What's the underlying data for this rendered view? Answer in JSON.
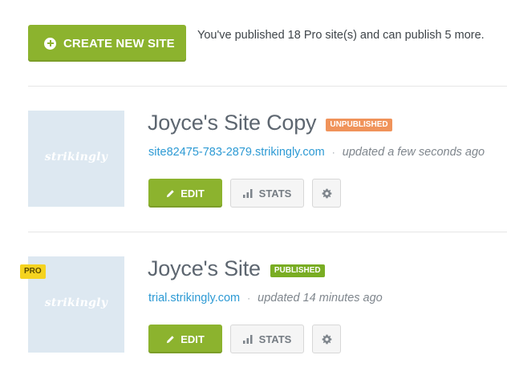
{
  "header": {
    "create_button_label": "CREATE NEW SITE",
    "publish_info": "You've published 18 Pro site(s) and can publish 5 more."
  },
  "sites": [
    {
      "title": "Joyce's Site Copy",
      "status": "UNPUBLISHED",
      "url": "site82475-783-2879.strikingly.com",
      "updated": "updated a few seconds ago",
      "thumbnail_logo": "strikingly",
      "pro_badge": "",
      "edit_label": "EDIT",
      "stats_label": "STATS"
    },
    {
      "title": "Joyce's Site",
      "status": "PUBLISHED",
      "url": "trial.strikingly.com",
      "updated": "updated 14 minutes ago",
      "thumbnail_logo": "strikingly",
      "pro_badge": "PRO",
      "edit_label": "EDIT",
      "stats_label": "STATS"
    }
  ],
  "separator": "·",
  "colors": {
    "accent_green": "#8cb32e",
    "unpublished_badge": "#f0935a",
    "published_badge": "#79ad23",
    "link_blue": "#2d9ad4",
    "pro_badge": "#f5d320",
    "thumbnail_bg": "#dde8f1"
  },
  "icons": {
    "create": "plus-circle-icon",
    "edit": "pencil-icon",
    "stats": "bar-chart-icon",
    "settings": "gear-icon"
  }
}
